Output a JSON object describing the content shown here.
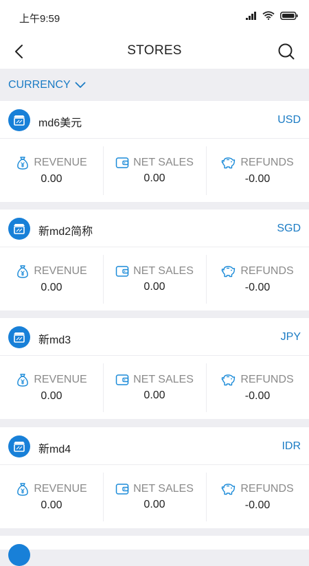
{
  "status": {
    "time": "上午9:59"
  },
  "nav": {
    "title": "STORES"
  },
  "filter": {
    "currency_label": "CURRENCY"
  },
  "metric_labels": {
    "revenue": "REVENUE",
    "net_sales": "NET SALES",
    "refunds": "REFUNDS"
  },
  "stores": [
    {
      "name": "md6美元",
      "currency": "USD",
      "revenue": "0.00",
      "net_sales": "0.00",
      "refunds": "-0.00"
    },
    {
      "name": "新md2简称",
      "currency": "SGD",
      "revenue": "0.00",
      "net_sales": "0.00",
      "refunds": "-0.00"
    },
    {
      "name": "新md3",
      "currency": "JPY",
      "revenue": "0.00",
      "net_sales": "0.00",
      "refunds": "-0.00"
    },
    {
      "name": "新md4",
      "currency": "IDR",
      "revenue": "0.00",
      "net_sales": "0.00",
      "refunds": "-0.00"
    }
  ],
  "colors": {
    "accent": "#1a7bc4",
    "icon_bg": "#1880d8",
    "background": "#eeeef2"
  },
  "icons": {
    "store": "store-icon",
    "revenue": "money-bag-icon",
    "net_sales": "wallet-icon",
    "refunds": "piggy-bank-icon"
  }
}
